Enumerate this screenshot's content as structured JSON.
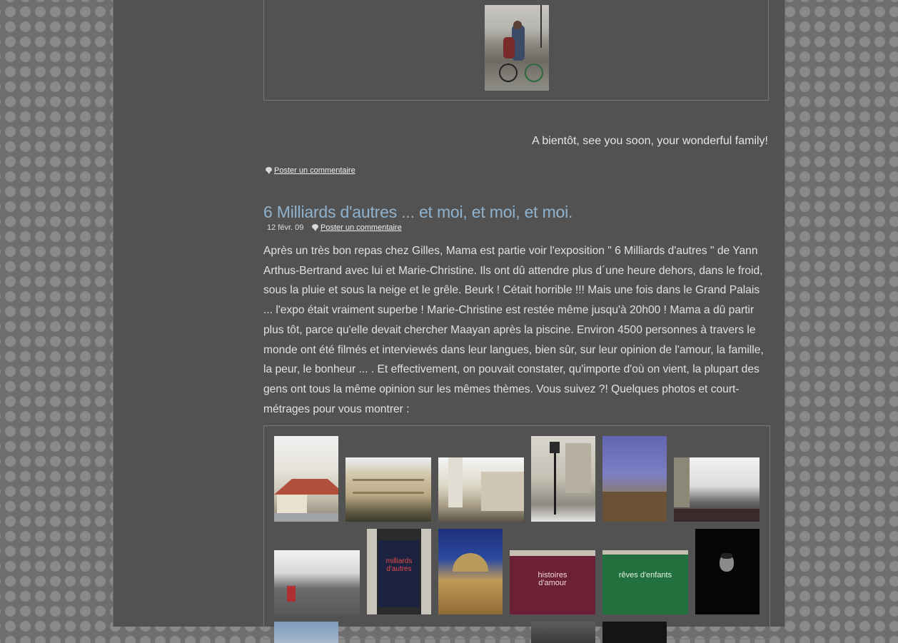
{
  "post_footer": {
    "farewell": "A bientôt, see you soon, your wonderful family!",
    "comment_link": "Poster un commentaire"
  },
  "post": {
    "title": "6 Milliards d'autres ... et moi, et moi, et moi.",
    "date": "12 févr. 09",
    "comment_link": "Poster un commentaire",
    "body": "Après un très bon repas chez Gilles, Mama est partie voir l'exposition \" 6 Milliards d'autres \" de Yann Arthus-Bertrand avec lui et Marie-Christine. Ils ont dû attendre plus d´une heure dehors, dans le froid, sous la pluie et sous la neige et le grêle. Beurk ! Cétait horrible !!! Mais une fois dans le Grand Palais ... l'expo était vraiment superbe ! Marie-Christine est restée même jusqu'à 20h00 ! Mama a dû partir plus tôt, parce qu'elle devait chercher Maayan après la piscine. Environ 4500 personnes à travers le monde ont été filmés et interviewés dans leur langues, bien sûr, sur leur opinion de l'amour, la famille, la peur, le bonheur ... . Et effectivement, on pouvait constater, qu'importe d'où on vient, la plupart des gens ont tous la même opinion sur les mêmes thèmes. Vous suivez ?! Quelques photos et court-métrages pour vous montrer :"
  },
  "posters": {
    "milliards": "milliards d'autres",
    "histoires": "histoires d'amour",
    "reves": "rêves d'enfants"
  }
}
